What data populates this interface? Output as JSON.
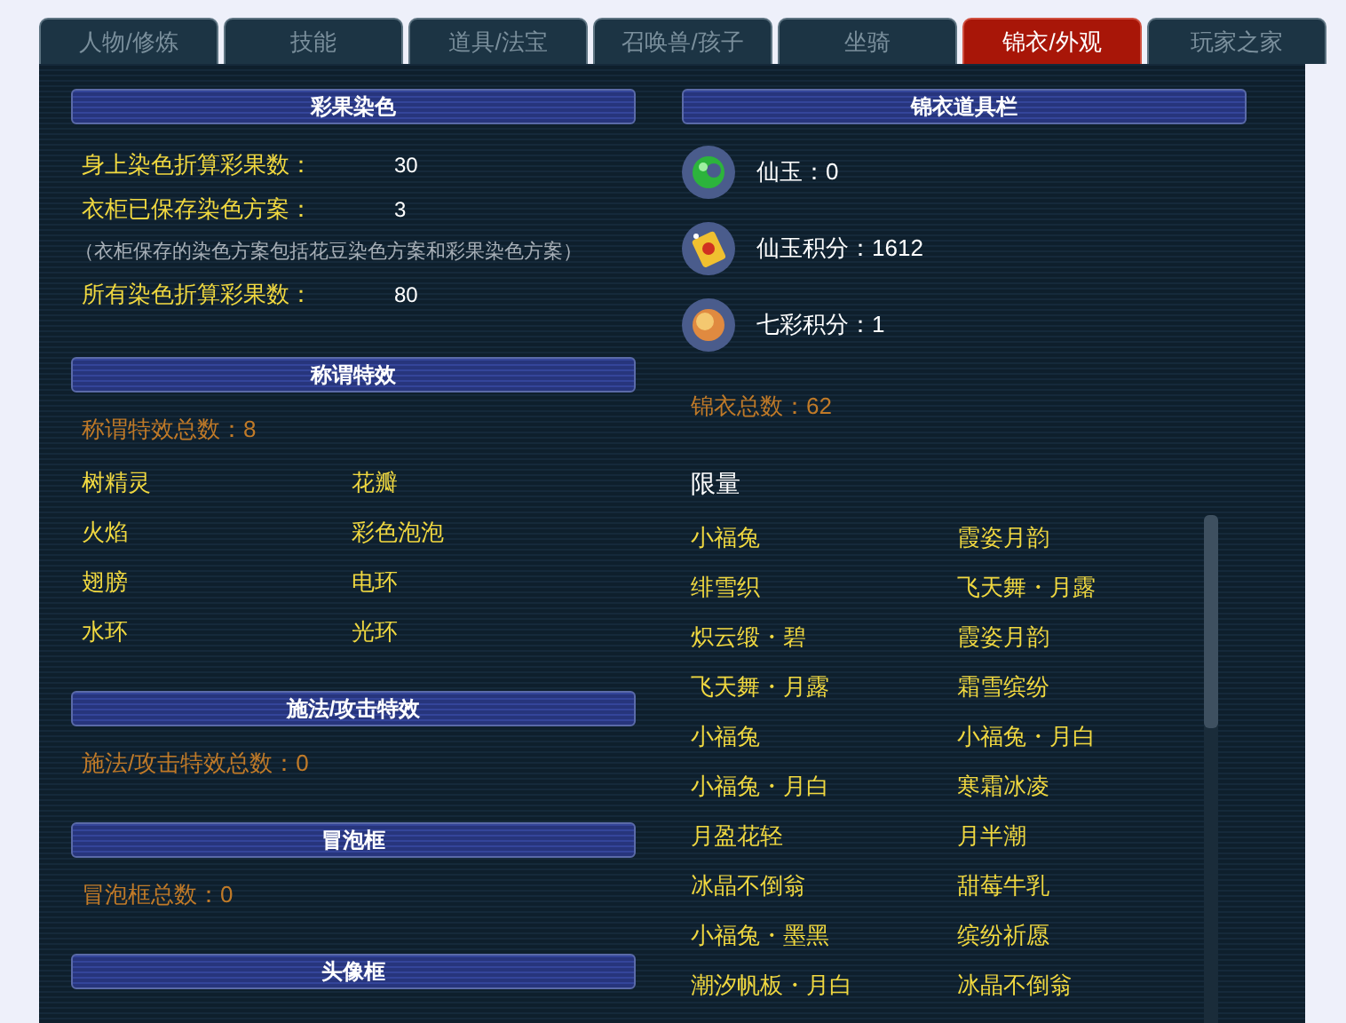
{
  "tabs": [
    {
      "label": "人物/修炼",
      "selected": false
    },
    {
      "label": "技能",
      "selected": false
    },
    {
      "label": "道具/法宝",
      "selected": false
    },
    {
      "label": "召唤兽/孩子",
      "selected": false
    },
    {
      "label": "坐骑",
      "selected": false
    },
    {
      "label": "锦衣/外观",
      "selected": true
    },
    {
      "label": "玩家之家",
      "selected": false
    }
  ],
  "dye_panel": {
    "title": "彩果染色",
    "rows": [
      {
        "kind": "stat",
        "label": "身上染色折算彩果数：",
        "value": "30"
      },
      {
        "kind": "stat",
        "label": "衣柜已保存染色方案：",
        "value": "3"
      },
      {
        "kind": "note",
        "text": "（衣柜保存的染色方案包括花豆染色方案和彩果染色方案）"
      },
      {
        "kind": "stat",
        "label": "所有染色折算彩果数：",
        "value": "80"
      }
    ]
  },
  "effect_sections": [
    {
      "title": "称谓特效",
      "total": "称谓特效总数：8",
      "items": [
        "树精灵",
        "花瓣",
        "火焰",
        "彩色泡泡",
        "翅膀",
        "电环",
        "水环",
        "光环"
      ]
    },
    {
      "title": "施法/攻击特效",
      "total": "施法/攻击特效总数：0"
    },
    {
      "title": "冒泡框",
      "total": "冒泡框总数：0"
    },
    {
      "title": "头像框"
    }
  ],
  "wardrobe_panel": {
    "title": "锦衣道具栏",
    "currencies": [
      {
        "kind": "jade",
        "label": "仙玉：0"
      },
      {
        "kind": "card",
        "label": "仙玉积分：1612"
      },
      {
        "kind": "orb",
        "label": "七彩积分：1"
      }
    ],
    "total": "锦衣总数：62",
    "group": "限量",
    "items": [
      "小福兔",
      "霞姿月韵",
      "绯雪织",
      "飞天舞・月露",
      "炽云缎・碧",
      "霞姿月韵",
      "飞天舞・月露",
      "霜雪缤纷",
      "小福兔",
      "小福兔・月白",
      "小福兔・月白",
      "寒霜冰凌",
      "月盈花轻",
      "月半潮",
      "冰晶不倒翁",
      "甜莓牛乳",
      "小福兔・墨黑",
      "缤纷祈愿",
      "潮汐帆板・月白",
      "冰晶不倒翁"
    ]
  }
}
